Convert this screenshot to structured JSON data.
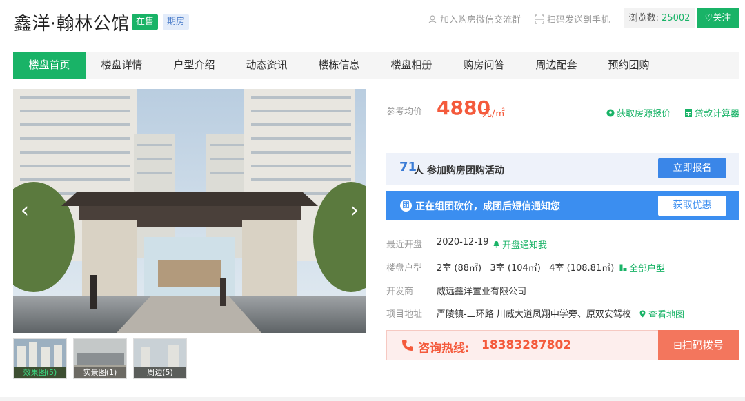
{
  "header": {
    "title": "鑫洋·翰林公馆",
    "badge_sale": "在售",
    "badge_phase": "期房",
    "wechat_link": "加入购房微信交流群",
    "scan_link": "扫码发送到手机",
    "views_label": "浏览数:",
    "views_count": "25002",
    "follow_label": "关注"
  },
  "nav": {
    "items": [
      "楼盘首页",
      "楼盘详情",
      "户型介绍",
      "动态资讯",
      "楼栋信息",
      "楼盘相册",
      "购房问答",
      "周边配套",
      "预约团购"
    ],
    "active_index": 0
  },
  "gallery": {
    "thumbs": [
      "效果图(5)",
      "实景图(1)",
      "周边(5)"
    ],
    "active_thumb": 0
  },
  "price": {
    "label": "参考均价",
    "value": "4880",
    "unit": "元/㎡",
    "quote_link": "获取房源报价",
    "calc_link": "贷款计算器"
  },
  "group_buy": {
    "count": "71",
    "text": "人 参加购房团购活动",
    "button": "立即报名"
  },
  "notice": {
    "icon": "团",
    "text": "正在组团砍价，成团后短信通知您",
    "button": "获取优惠"
  },
  "info": {
    "open_label": "最近开盘",
    "open_value": "2020-12-19",
    "open_link": "开盘通知我",
    "type_label": "楼盘户型",
    "type_value": "2室 (88㎡)   3室 (104㎡)   4室 (108.81㎡)",
    "type_link": "全部户型",
    "dev_label": "开发商",
    "dev_value": "威远鑫洋置业有限公司",
    "addr_label": "项目地址",
    "addr_value": "严陵镇-二环路 川威大道凤翔中学旁、原双安驾校",
    "addr_link": "查看地图"
  },
  "hotline": {
    "label": "咨询热线:",
    "number": "18383287802",
    "button": "扫码拨号"
  },
  "colors": {
    "brand_green": "#19b367",
    "price_red": "#f45a3c",
    "blue": "#3b8ef0"
  }
}
